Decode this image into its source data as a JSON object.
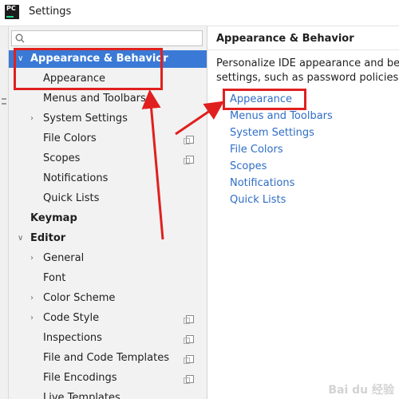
{
  "window": {
    "title": "Settings",
    "app_icon_text": "PC"
  },
  "search": {
    "value": "",
    "placeholder": ""
  },
  "tree": [
    {
      "label": "Appearance & Behavior",
      "expanded": true,
      "bold": true,
      "selected": true
    },
    {
      "label": "Appearance"
    },
    {
      "label": "Menus and Toolbars"
    },
    {
      "label": "System Settings",
      "collapsed": true
    },
    {
      "label": "File Colors",
      "copy_icon": true
    },
    {
      "label": "Scopes",
      "copy_icon": true
    },
    {
      "label": "Notifications"
    },
    {
      "label": "Quick Lists"
    },
    {
      "label": "Keymap",
      "bold": true
    },
    {
      "label": "Editor",
      "expanded": true,
      "bold": true
    },
    {
      "label": "General",
      "collapsed": true
    },
    {
      "label": "Font"
    },
    {
      "label": "Color Scheme",
      "collapsed": true
    },
    {
      "label": "Code Style",
      "collapsed": true,
      "copy_icon": true
    },
    {
      "label": "Inspections",
      "copy_icon": true
    },
    {
      "label": "File and Code Templates",
      "copy_icon": true
    },
    {
      "label": "File Encodings",
      "copy_icon": true
    },
    {
      "label": "Live Templates"
    }
  ],
  "content": {
    "title": "Appearance & Behavior",
    "description_lines": [
      "Personalize IDE appearance and behav",
      "settings, such as password policies, HTT"
    ],
    "links": [
      "Appearance",
      "Menus and Toolbars",
      "System Settings",
      "File Colors",
      "Scopes",
      "Notifications",
      "Quick Lists"
    ]
  },
  "watermark": "Bai du 经验",
  "colors": {
    "selection": "#3a7ad6",
    "link": "#2f6dc6",
    "annotation": "#e0201f"
  }
}
